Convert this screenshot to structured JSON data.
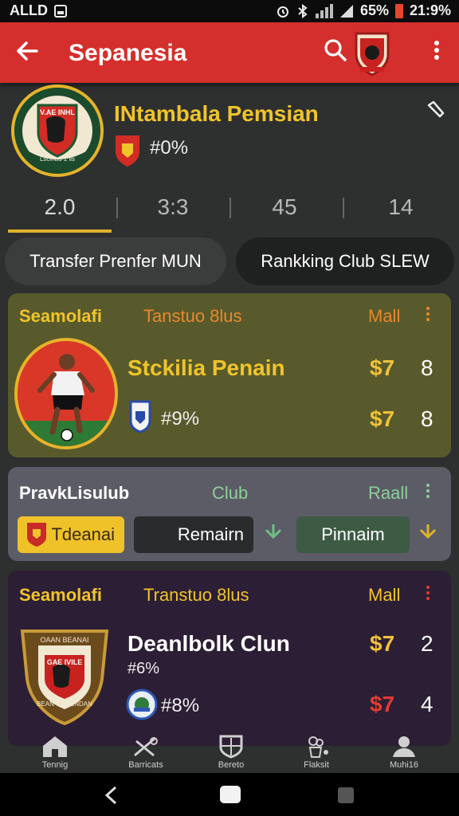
{
  "status": {
    "carrier": "ALLD",
    "battery_pct": "65%",
    "time": "21:9%"
  },
  "appbar": {
    "title": "Sepanesia"
  },
  "club": {
    "name": "INtambala Pemsian",
    "stat": "#0%",
    "crest_text_top": "V.AE INHL",
    "crest_text_bottom": "Lscinau 1 lis"
  },
  "tabs": [
    {
      "label": "2.0"
    },
    {
      "label": "3:3"
    },
    {
      "label": "45"
    },
    {
      "label": "14"
    }
  ],
  "pills": {
    "left": "Transfer Prenfer MUN",
    "right": "Rankking Club SLEW"
  },
  "card1": {
    "h_left": "Seamolafi",
    "h_mid": "Tanstuo 8lus",
    "h_right": "Mall",
    "name": "Stckilia Penain",
    "stat": "#9%",
    "row1": {
      "money": "$7",
      "num": "8"
    },
    "row2": {
      "money": "$7",
      "num": "8"
    }
  },
  "card2": {
    "h_left": "PravkLisulub",
    "h_mid": "Club",
    "h_right": "Raall",
    "btn_yellow": "Tdeanai",
    "btn_dark": "Remairn",
    "btn_green": "Pinnaim"
  },
  "card3": {
    "h_left": "Seamolafi",
    "h_mid": "Transtuo 8lus",
    "h_right": "Mall",
    "name": "Deanlbolk Clun",
    "stat1": "#6%",
    "stat2": "#8%",
    "crest_text_top": "OAAN BEANAI",
    "crest_text_mid": "GAE IVILE",
    "crest_text_bottom": "BEAN GCCENDAN",
    "row1": {
      "money": "$7",
      "num": "2"
    },
    "row2": {
      "money": "$7",
      "num": "4"
    }
  },
  "bottomnav": [
    {
      "label": "Tennig",
      "icon": "home-icon"
    },
    {
      "label": "Barricats",
      "icon": "ball-icon"
    },
    {
      "label": "Bereto",
      "icon": "shield-icon"
    },
    {
      "label": "Flaksit",
      "icon": "trophy-icon"
    },
    {
      "label": "Muhi16",
      "icon": "profile-icon"
    }
  ],
  "colors": {
    "appbar": "#d42f2c",
    "accent_gold": "#f0c42a",
    "card1": "#585a2c",
    "card2": "#5b5c66",
    "card3": "#2c1e34"
  }
}
